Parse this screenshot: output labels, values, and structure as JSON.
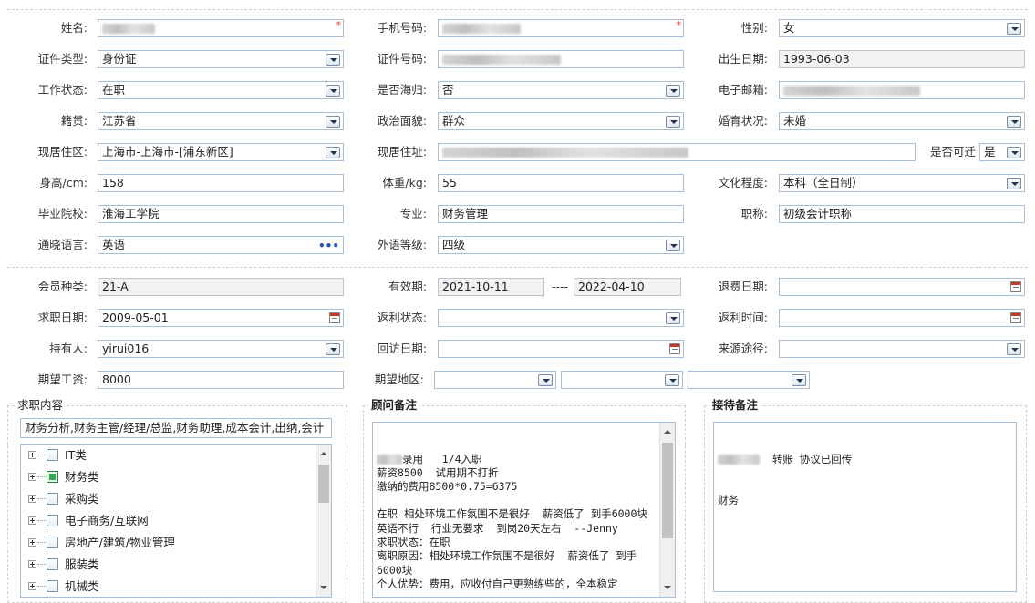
{
  "form": {
    "name": {
      "label": "姓名:"
    },
    "phone": {
      "label": "手机号码:"
    },
    "gender": {
      "label": "性别:",
      "value": "女"
    },
    "id_type": {
      "label": "证件类型:",
      "value": "身份证"
    },
    "id_no": {
      "label": "证件号码:"
    },
    "birth": {
      "label": "出生日期:",
      "value": "1993-06-03"
    },
    "work_status": {
      "label": "工作状态:",
      "value": "在职"
    },
    "returnee": {
      "label": "是否海归:",
      "value": "否"
    },
    "email": {
      "label": "电子邮箱:"
    },
    "native": {
      "label": "籍贯:",
      "value": "江苏省"
    },
    "political": {
      "label": "政治面貌:",
      "value": "群众"
    },
    "marital": {
      "label": "婚育状况:",
      "value": "未婚"
    },
    "residence_area": {
      "label": "现居住区:",
      "value": "上海市-上海市-[浦东新区]"
    },
    "residence_addr": {
      "label": "现居住址:"
    },
    "relocate": {
      "label": "是否可迁",
      "value": "是"
    },
    "height": {
      "label": "身高/cm:",
      "value": "158"
    },
    "weight": {
      "label": "体重/kg:",
      "value": "55"
    },
    "education": {
      "label": "文化程度:",
      "value": "本科（全日制）"
    },
    "school": {
      "label": "毕业院校:",
      "value": "淮海工学院"
    },
    "major": {
      "label": "专业:",
      "value": "财务管理"
    },
    "title": {
      "label": "职称:",
      "value": "初级会计职称"
    },
    "language": {
      "label": "通晓语言:",
      "value": "英语"
    },
    "lang_level": {
      "label": "外语等级:",
      "value": "四级"
    },
    "member_type": {
      "label": "会员种类:",
      "value": "21-A"
    },
    "valid": {
      "label": "有效期:",
      "from": "2021-10-11",
      "sep": "----",
      "to": "2022-04-10"
    },
    "refund_date": {
      "label": "退费日期:",
      "value": ""
    },
    "job_date": {
      "label": "求职日期:",
      "value": "2009-05-01"
    },
    "rebate_status": {
      "label": "返利状态:",
      "value": ""
    },
    "rebate_time": {
      "label": "返利时间:",
      "value": ""
    },
    "holder": {
      "label": "持有人:",
      "value": "yirui016"
    },
    "visit_date": {
      "label": "回访日期:",
      "value": ""
    },
    "source": {
      "label": "来源途径:",
      "value": ""
    },
    "salary": {
      "label": "期望工资:",
      "value": "8000"
    },
    "region": {
      "label": "期望地区:"
    }
  },
  "job_content": {
    "title": "求职内容",
    "summary": "财务分析,财务主管/经理/总监,财务助理,成本会计,出纳,会计",
    "tree": [
      {
        "label": "IT类",
        "checked": false
      },
      {
        "label": "财务类",
        "checked": true
      },
      {
        "label": "采购类",
        "checked": false
      },
      {
        "label": "电子商务/互联网",
        "checked": false
      },
      {
        "label": "房地产/建筑/物业管理",
        "checked": false
      },
      {
        "label": "服装类",
        "checked": false
      },
      {
        "label": "机械类",
        "checked": false
      }
    ]
  },
  "advisor_notes": {
    "title": "顾问备注",
    "lines": [
      "录用   1/4入职",
      "薪资8500  试用期不打折",
      "缴纳的费用8500*0.75=6375",
      "",
      "在职 相处环境工作氛围不是很好  薪资低了 到手6000块  英语不行  行业无要求  到岗20天左右  --Jenny",
      "求职状态：在职",
      "离职原因：相处环境工作氛围不是很好  薪资低了 到手6000块",
      "个人优势：费用，应收付自己更熟练些的，全本稳定"
    ]
  },
  "reception_notes": {
    "title": "接待备注",
    "line1": "转账 协议已回传",
    "line2": "财务"
  }
}
